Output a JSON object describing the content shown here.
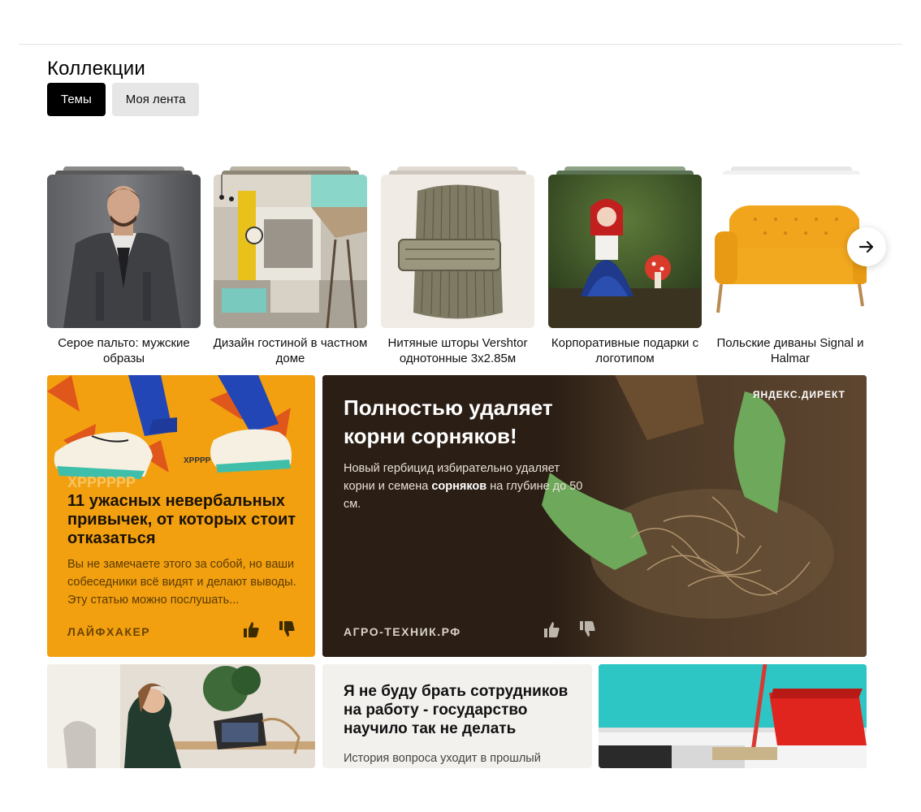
{
  "page": {
    "title": "Коллекции"
  },
  "tabs": [
    {
      "label": "Темы",
      "active": true
    },
    {
      "label": "Моя лента",
      "active": false
    }
  ],
  "collections": [
    {
      "caption": "Серое пальто: мужские образы",
      "icon": "man-coat-photo"
    },
    {
      "caption": "Дизайн гостиной в частном доме",
      "icon": "living-room-photo"
    },
    {
      "caption": "Нитяные шторы Vershtor однотонные 3х2.85м",
      "icon": "thread-curtain-photo"
    },
    {
      "caption": "Корпоративные подарки с логотипом",
      "icon": "doll-photo"
    },
    {
      "caption": "Польские диваны Signal и Halmar",
      "icon": "yellow-sofa-photo"
    }
  ],
  "carousel": {
    "next_icon": "arrow-right-icon"
  },
  "feed": {
    "article1": {
      "title": "11 ужасных невербальных привычек, от которых стоит отказаться",
      "text": "Вы не замечаете этого за собой, но ваши собеседники всё видят и делают выводы. Эту статью можно послушать...",
      "source": "ЛАЙФХАКЕР",
      "illustration_text": "XPPPPPP"
    },
    "ad": {
      "title": "Полностью удаляет корни сорняков!",
      "text_before": "Новый гербицид избирательно удаляет корни и семена ",
      "text_bold": "сорняков",
      "text_after": " на глубине до 50 см.",
      "label": "ЯНДЕКС.ДИРЕКТ",
      "source": "АГРО-ТЕХНИК.РФ"
    },
    "article2": {
      "title": "Я не буду брать сотрудников на работу - государство научило так не делать",
      "text": "История вопроса уходит в прошлый"
    }
  },
  "colors": {
    "orange_card": "#f2a010",
    "ad_card": "#2b1e14",
    "tab_active": "#000000"
  }
}
